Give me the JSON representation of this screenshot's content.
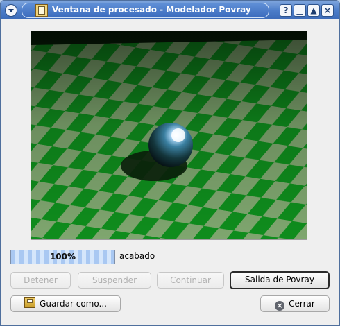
{
  "window": {
    "title": "Ventana de procesado - Modelador Povray"
  },
  "progress": {
    "percent": 100,
    "percent_label": "100%",
    "status": "acabado"
  },
  "buttons": {
    "stop": "Detener",
    "suspend": "Suspender",
    "continue": "Continuar",
    "povray_output": "Salida de Povray",
    "save_as": "Guardar como...",
    "close": "Cerrar"
  },
  "icons": {
    "window_menu": "chevron-down-icon",
    "app": "povray-app-icon",
    "help": "help-icon",
    "minimize": "minimize-icon",
    "maximize": "maximize-icon",
    "close": "close-icon",
    "save": "save-icon",
    "close_button": "close-icon"
  },
  "colors": {
    "title_bar": "#4c7dc9",
    "checker_green": "#0f8d1d",
    "checker_light": "#7fa66f"
  }
}
